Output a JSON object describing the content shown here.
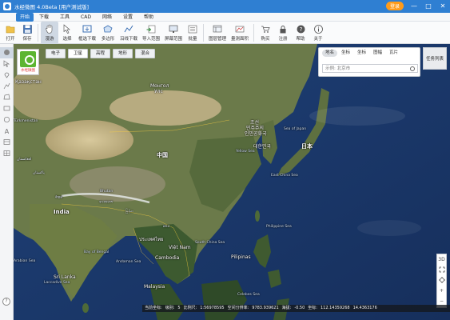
{
  "window": {
    "title": "水经微图 4.0Beta [用户测试版]",
    "login_label": "登录",
    "minimize": "—",
    "maximize": "□",
    "close": "✕"
  },
  "menu": [
    "开始",
    "下载",
    "工具",
    "CAD",
    "网络",
    "设置",
    "帮助"
  ],
  "toolbar": [
    {
      "label": "打开",
      "icon": "folder-open-icon"
    },
    {
      "label": "保存",
      "icon": "save-icon"
    },
    {
      "label": "漫游",
      "icon": "hand-pan-icon",
      "active": true
    },
    {
      "label": "选择",
      "icon": "pointer-select-icon"
    },
    {
      "label": "框选下载",
      "icon": "rect-download-icon"
    },
    {
      "label": "多边形",
      "icon": "polygon-icon"
    },
    {
      "label": "沿线下载",
      "icon": "polyline-download-icon"
    },
    {
      "label": "导入范围",
      "icon": "import-range-icon"
    },
    {
      "label": "屏幕范围",
      "icon": "screen-range-icon"
    },
    {
      "label": "批量",
      "icon": "batch-icon"
    },
    {
      "label": "图层管理",
      "icon": "layers-icon"
    },
    {
      "label": "量测面积",
      "icon": "area-measure-icon"
    },
    {
      "label": "购买",
      "icon": "cart-icon"
    },
    {
      "label": "注册",
      "icon": "lock-icon"
    },
    {
      "label": "帮助",
      "icon": "question-icon"
    },
    {
      "label": "关于",
      "icon": "info-icon"
    }
  ],
  "map_tabs": [
    "电子",
    "卫星",
    "高程",
    "地形",
    "混合"
  ],
  "map_tabs_active": "卫星",
  "logo_text": "水经微图",
  "search": {
    "tabs": [
      "地名",
      "坐标",
      "坐标",
      "图幅",
      "瓦片"
    ],
    "active": "地名",
    "placeholder": "示例: 北京市"
  },
  "tasklist_label": "任务列表",
  "map_labels": {
    "mongolia_cn": "Монгол",
    "mongolia_2": "Улс",
    "china": "中国",
    "korea_n": "조선",
    "korea_n2": "민주주의",
    "korea_n3": "인민공화국",
    "korea_s": "대한민국",
    "japan_jp": "日本",
    "japan_en": "Sea of Japan",
    "yellow_sea": "Yellow Sea",
    "east_china_sea": "East China Sea",
    "india": "India",
    "nepal": "नेपाल",
    "bhutan": "Bhutan",
    "bangladesh": "বাংলাদেশ",
    "myanmar": "မြန်မာ",
    "thailand": "ประเทศไทย",
    "laos": "ລາວ",
    "vietnam": "Việt Nam",
    "cambodia": "Cambodia",
    "philippines": "Pilipinas",
    "philippine_sea": "Philippine Sea",
    "south_china_sea": "South China Sea",
    "bay_of_bengal": "Bay of Bengal",
    "andaman_sea": "Andaman Sea",
    "sri_lanka": "Sri Lanka",
    "laccadive_sea": "Laccadive Sea",
    "malaysia": "Malaysia",
    "celebes_sea": "Celebes Sea",
    "arabian_sea": "Arabian Sea",
    "turkmenistan": "Türkmenistan",
    "afghanistan": "افغانستان",
    "pakistan": "پاکستان",
    "kazakh": "Қазақстан"
  },
  "right_controls": [
    "3D",
    "fit-extent-icon",
    "locate-icon",
    "+",
    "−"
  ],
  "status": {
    "label_coord": "当前坐标:",
    "level_label": "级别:",
    "level": "5",
    "scale_label": "比例尺:",
    "scale": "1:56978595",
    "resolution_label": "空间分辨率:",
    "resolution": "9783.939621",
    "elevation_label": "海拔:",
    "elevation": "-0.50",
    "coord_label": "坐标:",
    "lon": "112.14359268",
    "lat": "14.4363176"
  },
  "colors": {
    "titlebar": "#2f7fd2",
    "login": "#ff9b1a",
    "ocean": "#1d3a6e",
    "land": "#6b7a4a",
    "desert": "#c9b78d"
  }
}
